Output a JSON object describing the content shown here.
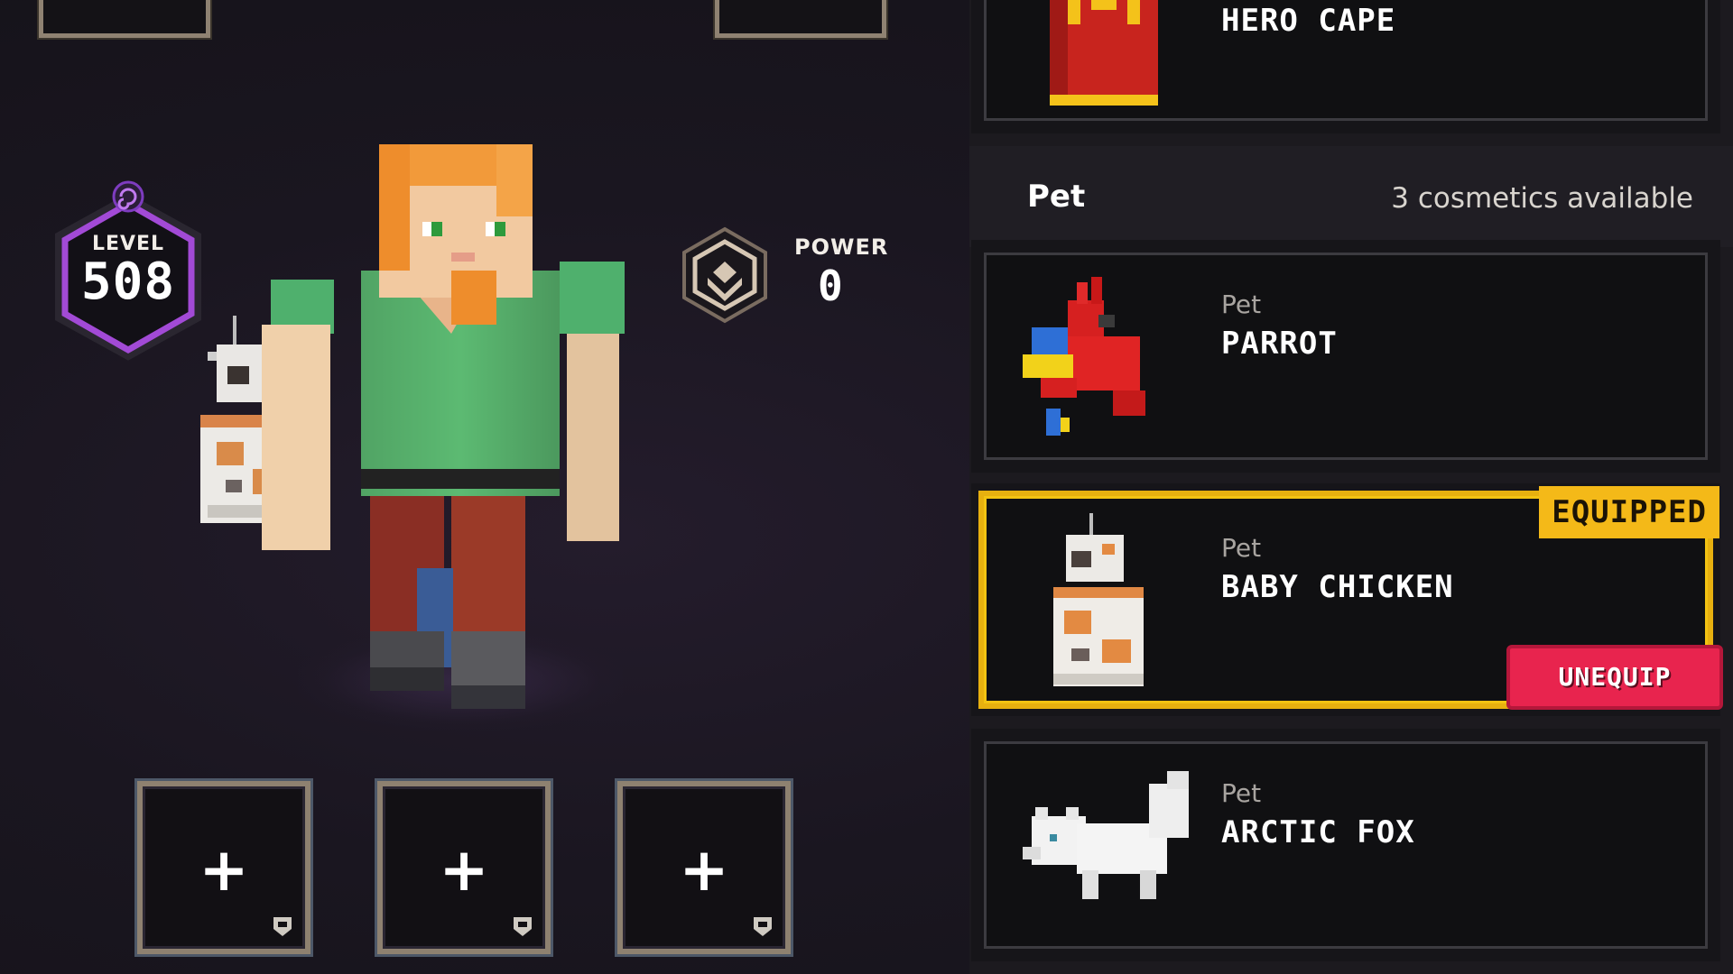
{
  "hero": {
    "level_label": "LEVEL",
    "level_value": "508",
    "power_label": "POWER",
    "power_value": "0"
  },
  "slots": {
    "add_symbol": "+"
  },
  "cape": {
    "name": "HERO CAPE"
  },
  "pet_section": {
    "title": "Pet",
    "count_text": "3 cosmetics available",
    "items": [
      {
        "type": "Pet",
        "name": "PARROT",
        "icon": "parrot-icon",
        "equipped": false
      },
      {
        "type": "Pet",
        "name": "BABY CHICKEN",
        "icon": "baby-chicken-icon",
        "equipped": true,
        "equipped_label": "EQUIPPED",
        "action_label": "UNEQUIP"
      },
      {
        "type": "Pet",
        "name": "ARCTIC FOX",
        "icon": "arctic-fox-icon",
        "equipped": false
      }
    ]
  },
  "colors": {
    "equipped": "#f4b918",
    "unequip": "#e8244e",
    "level_ring": "#a24ad6"
  }
}
